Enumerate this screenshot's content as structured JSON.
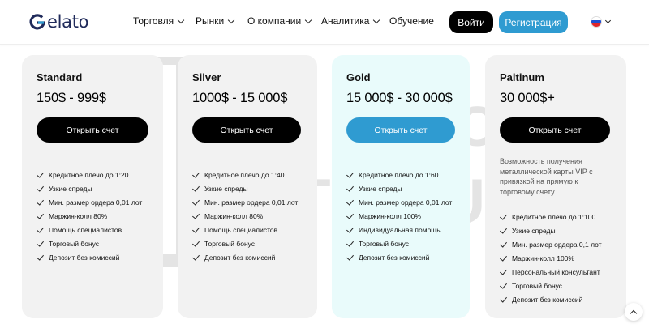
{
  "brand": {
    "logo_text": "elato"
  },
  "nav": [
    {
      "label": "Торговля",
      "has_dropdown": true
    },
    {
      "label": "Рынки",
      "has_dropdown": true
    },
    {
      "label": "О компании",
      "has_dropdown": true
    },
    {
      "label": "Аналитика",
      "has_dropdown": true
    },
    {
      "label": "Обучение",
      "has_dropdown": false
    }
  ],
  "header": {
    "login_label": "Войти",
    "register_label": "Регистрация",
    "language_icon": "russia-flag-icon"
  },
  "colors": {
    "accent": "#2f9bd1",
    "dark": "#000000",
    "card_bg": "#f2f2f2",
    "gold_card_bg": "#e9fbfb"
  },
  "plans": [
    {
      "name": "Standard",
      "price": "150$ - 999$",
      "button": "Открыть счет",
      "description": "",
      "features": [
        "Кредитное плечо до 1:20",
        "Узкие спреды",
        "Мин. размер ордера 0,01 лот",
        "Маржин-колл 80%",
        "Помощь специалистов",
        "Торговый бонус",
        "Депозит без комиссий"
      ]
    },
    {
      "name": "Silver",
      "price": "1000$ - 15 000$",
      "button": "Открыть счет",
      "description": "",
      "features": [
        "Кредитное плечо до 1:40",
        "Узкие спреды",
        "Мин. размер ордера 0,01 лот",
        "Маржин-колл 80%",
        "Помощь специалистов",
        "Торговый бонус",
        "Депозит без комиссий"
      ]
    },
    {
      "name": "Gold",
      "price": "15 000$ - 30 000$",
      "button": "Открыть счет",
      "description": "",
      "features": [
        "Кредитное плечо до 1:60",
        "Узкие спреды",
        "Мин. размер ордера 0,01 лот",
        "Маржин-колл 100%",
        "Индивидуальная помощь",
        "Торговый бонус",
        "Депозит без комиссий"
      ]
    },
    {
      "name": "Paltinum",
      "price": "30 000$+",
      "button": "Открыть счет",
      "description": "Возможность получения металлической карты VIP с привязкой на прямую к торговому счету",
      "features": [
        "Кредитное плечо до 1:100",
        "Узкие спреды",
        "Мин. размер ордера 0,1 лот",
        "Маржин-колл 100%",
        "Персональный консультант",
        "Торговый бонус",
        "Депозит без комиссий"
      ]
    }
  ],
  "watermark": {
    "line1": "BROKER",
    "line2": "TRIBUNAL"
  }
}
